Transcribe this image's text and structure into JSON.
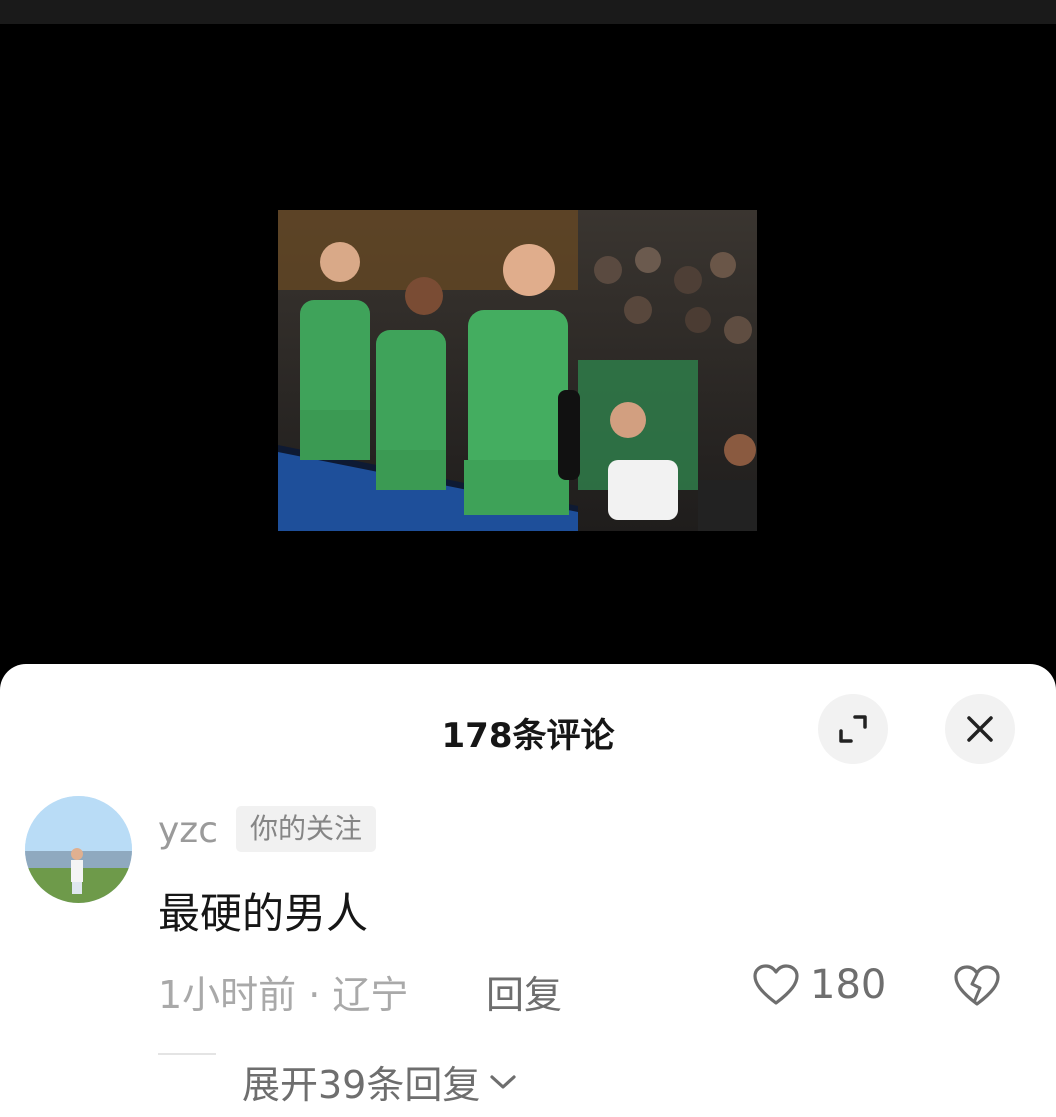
{
  "comments_header": {
    "title": "178条评论",
    "expand_icon": "expand-icon",
    "close_icon": "close-icon"
  },
  "comment": {
    "username": "yzc",
    "follow_tag": "你的关注",
    "text": "最硬的男人",
    "time_location": "1小时前 · 辽宁",
    "reply_label": "回复",
    "like_icon": "heart-outline-icon",
    "like_count": "180",
    "dislike_icon": "broken-heart-icon",
    "expand_replies": "展开39条回复"
  },
  "colors": {
    "jersey_green": "#3fa35a",
    "background_dark": "#000000",
    "sheet_bg": "#ffffff"
  }
}
